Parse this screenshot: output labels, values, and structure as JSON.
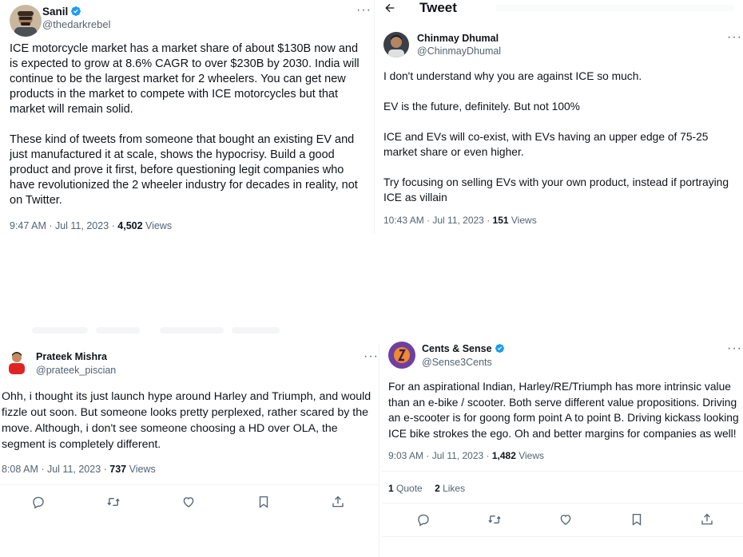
{
  "tweet1": {
    "name": "Sanil",
    "handle": "@thedarkrebel",
    "para1": "ICE motorcycle market has a market share of about $130B now and is expected to grow at 8.6% CAGR to over $230B by 2030. India will continue to be the largest market for 2 wheelers. You can get new products in the market to compete with ICE motorcycles but that market will remain solid.",
    "para2": "These kind of tweets from someone that bought an existing EV and just manufactured it at scale, shows the hypocrisy. Build a good product and prove it first, before questioning legit companies who have revolutionized the 2 wheeler industry for decades in reality, not on Twitter.",
    "time": "9:47 AM · Jul 11, 2023 · ",
    "views_count": "4,502",
    "views_label": " Views"
  },
  "tweet2": {
    "header_title": "Tweet",
    "name": "Chinmay Dhumal",
    "handle": "@ChinmayDhumal",
    "para1": "I don't understand why you are against ICE so much.",
    "para2": "EV is the future, definitely. But not 100%",
    "para3": "ICE and EVs will co-exist, with EVs having an upper edge of 75-25 market share or even higher.",
    "para4": "Try focusing on selling EVs with your own product, instead if portraying ICE as villain",
    "time": "10:43 AM · Jul 11, 2023 · ",
    "views_count": "151",
    "views_label": " Views"
  },
  "tweet3": {
    "name": "Prateek Mishra",
    "handle": "@prateek_piscian",
    "para1": "Ohh, i thought its just launch hype around Harley and Triumph, and would fizzle out soon. But someone looks pretty perplexed, rather scared by the move. Although, i don't see someone choosing a HD over OLA, the segment is completely different.",
    "time": "8:08 AM · Jul 11, 2023 · ",
    "views_count": "737",
    "views_label": " Views"
  },
  "tweet4": {
    "name": "Cents & Sense",
    "handle": "@Sense3Cents",
    "para1": "For an aspirational Indian, Harley/RE/Triumph has more intrinsic value than an e-bike / scooter. Both serve different value propositions. Driving an e-scooter is for goong form point A to point B. Driving kickass looking ICE bike strokes the ego. Oh and better margins for companies as well!",
    "time": "9:03 AM · Jul 11, 2023 · ",
    "views_count": "1,482",
    "views_label": " Views",
    "quotes_count": "1",
    "quotes_label": " Quote",
    "likes_count": "2",
    "likes_label": " Likes"
  },
  "colors": {
    "text": "#0f1419",
    "secondary": "#536471",
    "verified": "#1d9bf0",
    "divider": "#eff3f4"
  },
  "icons": [
    "back-arrow-icon",
    "more-icon",
    "verified-badge-icon",
    "reply-icon",
    "retweet-icon",
    "like-icon",
    "bookmark-icon",
    "share-icon"
  ]
}
